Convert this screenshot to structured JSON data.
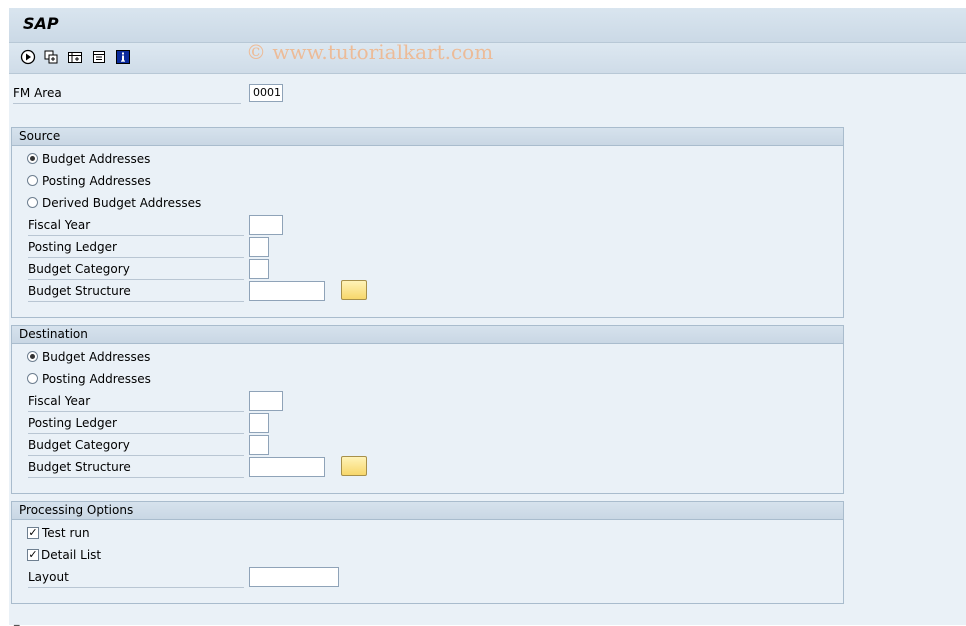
{
  "app": {
    "title": "SAP"
  },
  "watermark": "© www.tutorialkart.com",
  "toolbar": {
    "icons": [
      "execute-icon",
      "variants-icon",
      "multiple-selection-icon",
      "selection-options-icon",
      "info-icon"
    ]
  },
  "fm_area": {
    "label": "FM Area",
    "value": "0001"
  },
  "source": {
    "title": "Source",
    "radio_budget": "Budget Addresses",
    "radio_posting": "Posting Addresses",
    "radio_derived": "Derived Budget Addresses",
    "selected": "Budget Addresses",
    "fiscal_year": "Fiscal Year",
    "posting_ledger": "Posting Ledger",
    "budget_category": "Budget Category",
    "budget_structure": "Budget Structure"
  },
  "destination": {
    "title": "Destination",
    "radio_budget": "Budget Addresses",
    "radio_posting": "Posting Addresses",
    "selected": "Budget Addresses",
    "fiscal_year": "Fiscal Year",
    "posting_ledger": "Posting Ledger",
    "budget_category": "Budget Category",
    "budget_structure": "Budget Structure"
  },
  "processing": {
    "title": "Processing Options",
    "test_run": "Test run",
    "test_run_checked": true,
    "detail_list": "Detail List",
    "detail_list_checked": true,
    "layout": "Layout"
  },
  "status": "_"
}
